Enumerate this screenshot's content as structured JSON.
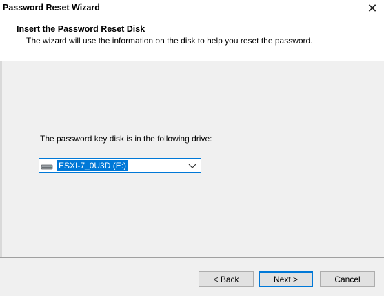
{
  "window": {
    "title": "Password Reset Wizard",
    "close_glyph": "✕"
  },
  "header": {
    "title": "Insert the Password Reset Disk",
    "subtitle": "The wizard will use the information on the disk to help you reset the password."
  },
  "main": {
    "prompt": "The password key disk is in the following drive:",
    "drive_select": {
      "selected_value": "ESXI-7_0U3D (E:)",
      "icon": "drive-icon"
    }
  },
  "buttons": {
    "back": "< Back",
    "next": "Next >",
    "cancel": "Cancel"
  },
  "colors": {
    "accent": "#0078d7",
    "panel": "#f0f0f0"
  }
}
